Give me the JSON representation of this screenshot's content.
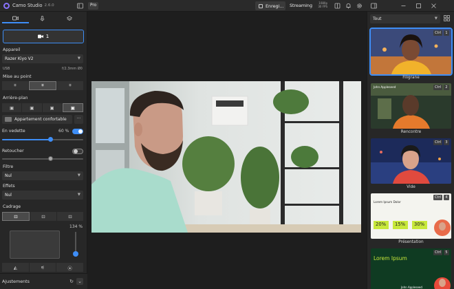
{
  "app": {
    "name": "Camo Studio",
    "version": "2.6.0",
    "badge": "Pro"
  },
  "titlebar": {
    "record_label": "Enregi...",
    "stream_label": "Streaming",
    "stream_stats": [
      "1080p",
      "30 FPS"
    ]
  },
  "left": {
    "camera_button_label": "1",
    "device": {
      "label": "Appareil",
      "value": "Razer Kiyo V2",
      "usb": "USB",
      "lens_info": "f/2.3mm Ø0"
    },
    "focus": {
      "label": "Mise au point"
    },
    "background": {
      "label": "Arrière-plan",
      "value": "Appartement confortable"
    },
    "blur": {
      "label": "En vedette",
      "value": "60 %",
      "percent": 60,
      "enabled": true
    },
    "retouch": {
      "label": "Retoucher",
      "enabled": false,
      "level": 60
    },
    "filter": {
      "label": "Filtre",
      "value": "Nul"
    },
    "effects": {
      "label": "Effets",
      "value": "Nul"
    },
    "framing": {
      "label": "Cadrage",
      "zoom": "134 %"
    },
    "adjustments_label": "Ajustements"
  },
  "right": {
    "filter_value": "Tout",
    "scenes": [
      {
        "label": "Filigrane",
        "ctrl": "Ctrl",
        "num": "1",
        "active": true,
        "overlay": ""
      },
      {
        "label": "Rencontre",
        "ctrl": "Ctrl",
        "num": "2",
        "active": false,
        "overlay": "John Appleseed"
      },
      {
        "label": "Vide",
        "ctrl": "Ctrl",
        "num": "3",
        "active": false,
        "overlay": ""
      },
      {
        "label": "Présentation",
        "ctrl": "Ctrl",
        "num": "4",
        "active": false,
        "overlay": "Lorem Ipsum Dolor",
        "stats": [
          "20%",
          "15%",
          "30%"
        ]
      },
      {
        "label": "",
        "ctrl": "Ctrl",
        "num": "5",
        "active": false,
        "overlay": "Lorem Ipsum",
        "footer": "John Appleseed"
      }
    ]
  },
  "colors": {
    "accent": "#3e8ef7",
    "panel": "#272727",
    "stage": "#1e1e1e"
  }
}
